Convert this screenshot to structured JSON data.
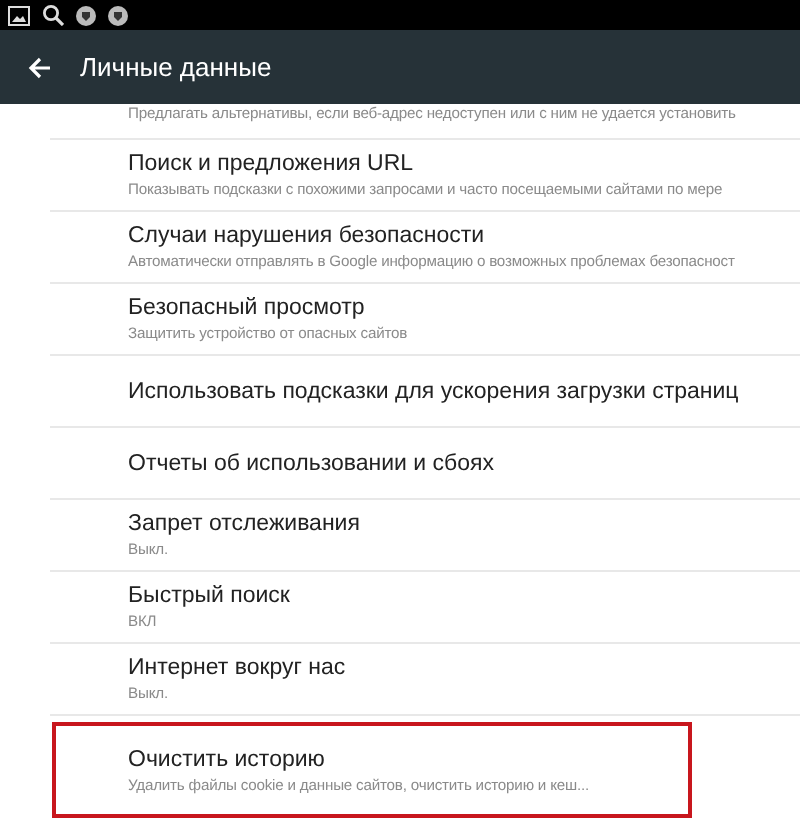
{
  "status_bar": {
    "icons": [
      {
        "kind": "image"
      },
      {
        "kind": "search"
      },
      {
        "kind": "shield"
      },
      {
        "kind": "shield"
      }
    ]
  },
  "toolbar": {
    "title": "Личные данные"
  },
  "items": [
    {
      "subtitle": "Предлагать альтернативы, если веб-адрес недоступен или с ним не удается установить",
      "highlighted": false
    },
    {
      "title": "Поиск и предложения URL",
      "subtitle": "Показывать подсказки с похожими запросами и часто посещаемыми сайтами по мере",
      "highlighted": false
    },
    {
      "title": "Случаи нарушения безопасности",
      "subtitle": "Автоматически отправлять в Google информацию о возможных проблемах безопасност",
      "highlighted": false
    },
    {
      "title": "Безопасный просмотр",
      "subtitle": "Защитить устройство от опасных сайтов",
      "highlighted": false
    },
    {
      "title": "Использовать подсказки для ускорения загрузки страниц",
      "highlighted": false
    },
    {
      "title": "Отчеты об использовании и сбоях",
      "highlighted": false
    },
    {
      "title": "Запрет отслеживания",
      "subtitle": "Выкл.",
      "highlighted": false
    },
    {
      "title": "Быстрый поиск",
      "subtitle": "ВКЛ",
      "highlighted": false
    },
    {
      "title": "Интернет вокруг нас",
      "subtitle": "Выкл.",
      "highlighted": false
    },
    {
      "title": "Очистить историю",
      "subtitle": "Удалить файлы cookie и данные сайтов, очистить историю и кеш...",
      "highlighted": true
    }
  ]
}
